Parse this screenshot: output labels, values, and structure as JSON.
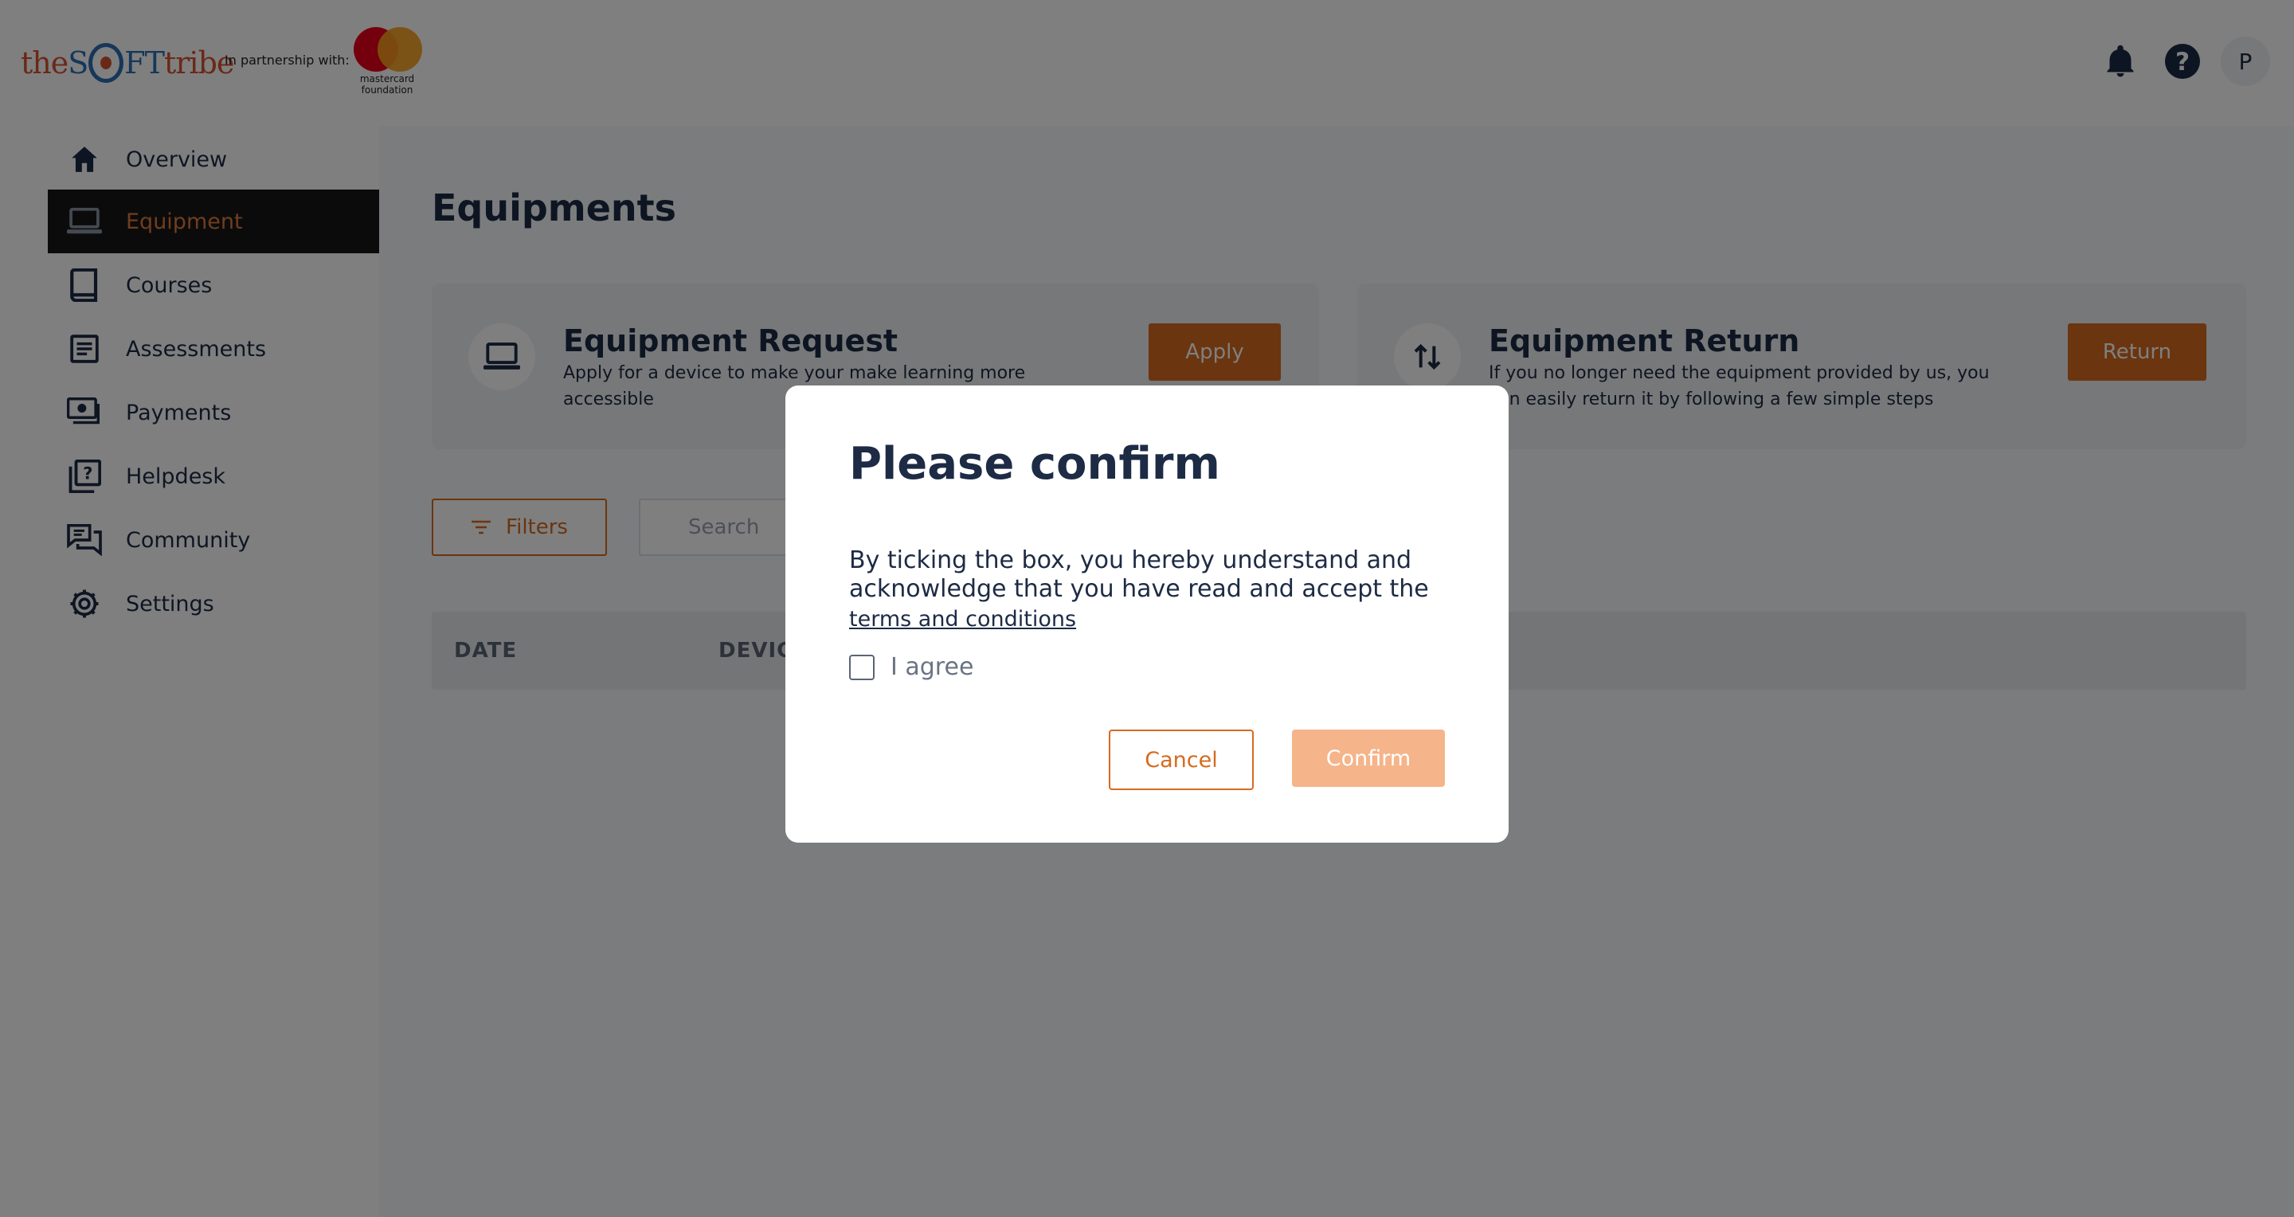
{
  "header": {
    "logo": {
      "part1": "the",
      "part2": "S",
      "part3": "FT",
      "part4": "tribe"
    },
    "partner_text": "In partnership with:",
    "partner_logo_text": "mastercard foundation",
    "avatar_initial": "P",
    "icons": [
      "bell-icon",
      "help-icon"
    ]
  },
  "sidebar": {
    "items": [
      {
        "label": "Overview",
        "icon": "home-icon",
        "active": false
      },
      {
        "label": "Equipment",
        "icon": "laptop-icon",
        "active": true
      },
      {
        "label": "Courses",
        "icon": "book-icon",
        "active": false
      },
      {
        "label": "Assessments",
        "icon": "document-icon",
        "active": false
      },
      {
        "label": "Payments",
        "icon": "payments-icon",
        "active": false
      },
      {
        "label": "Helpdesk",
        "icon": "helpdesk-icon",
        "active": false
      },
      {
        "label": "Community",
        "icon": "chat-icon",
        "active": false
      },
      {
        "label": "Settings",
        "icon": "gear-icon",
        "active": false
      }
    ]
  },
  "main": {
    "title": "Equipments",
    "request_card": {
      "title": "Equipment Request",
      "description": "Apply for a device to make your make learning more accessible",
      "button": "Apply"
    },
    "return_card": {
      "title": "Equipment Return",
      "description": "If you no longer need the equipment provided by us, you can easily return it by following a few simple steps",
      "button": "Return"
    },
    "filters_label": "Filters",
    "search_placeholder": "Search",
    "table_headers": [
      "DATE",
      "DEVICE"
    ]
  },
  "modal": {
    "title": "Please confirm",
    "text": "By ticking the box, you hereby understand and acknowledge that you have read and accept the",
    "link": "terms and conditions",
    "checkbox_label": "I agree",
    "checked": false,
    "cancel": "Cancel",
    "confirm": "Confirm"
  },
  "colors": {
    "accent": "#d66a1e",
    "accent_disabled": "#f5b48a",
    "text": "#1d2b45",
    "active_nav_bg": "#161616",
    "active_nav_text": "#e07a3f"
  }
}
